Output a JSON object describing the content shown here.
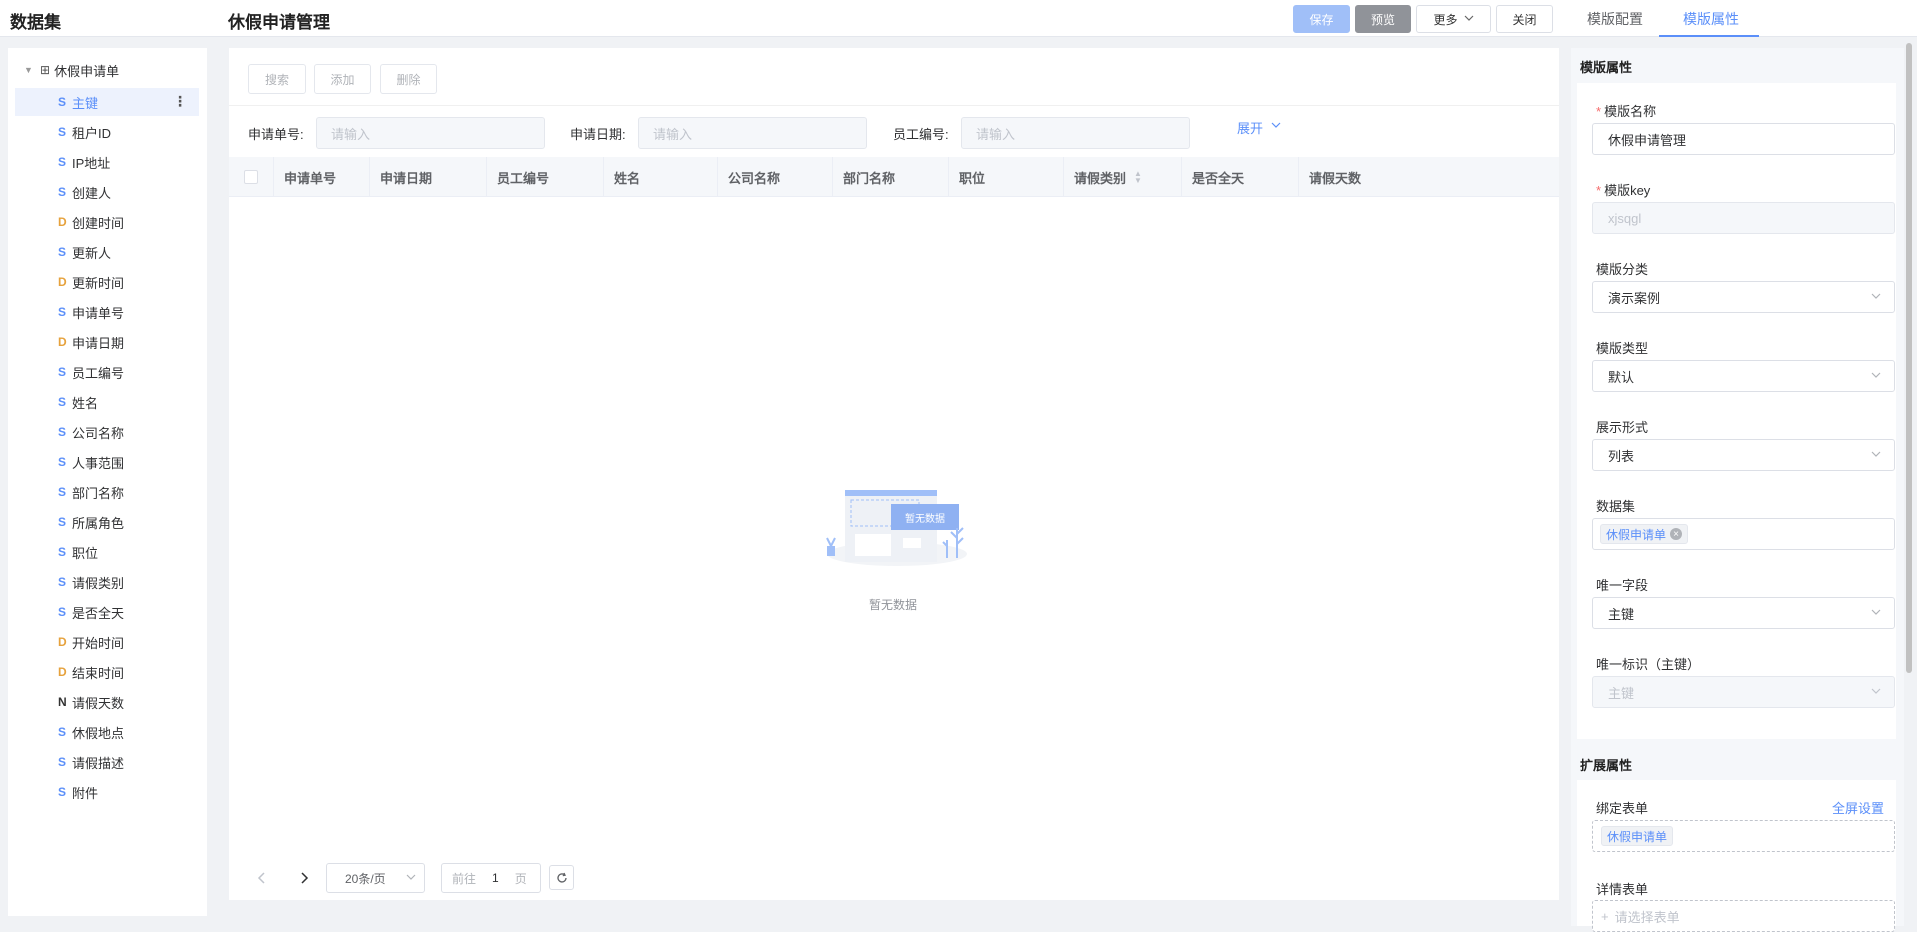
{
  "header": {
    "brand": "数据集",
    "page_title": "休假申请管理",
    "save": "保存",
    "preview": "预览",
    "more": "更多",
    "close": "关闭",
    "tab_config": "模版配置",
    "tab_props": "模版属性"
  },
  "tree": {
    "root": "休假申请单",
    "items": [
      {
        "type": "S",
        "name": "主键"
      },
      {
        "type": "S",
        "name": "租户ID"
      },
      {
        "type": "S",
        "name": "IP地址"
      },
      {
        "type": "S",
        "name": "创建人"
      },
      {
        "type": "D",
        "name": "创建时间"
      },
      {
        "type": "S",
        "name": "更新人"
      },
      {
        "type": "D",
        "name": "更新时间"
      },
      {
        "type": "S",
        "name": "申请单号"
      },
      {
        "type": "D",
        "name": "申请日期"
      },
      {
        "type": "S",
        "name": "员工编号"
      },
      {
        "type": "S",
        "name": "姓名"
      },
      {
        "type": "S",
        "name": "公司名称"
      },
      {
        "type": "S",
        "name": "人事范围"
      },
      {
        "type": "S",
        "name": "部门名称"
      },
      {
        "type": "S",
        "name": "所属角色"
      },
      {
        "type": "S",
        "name": "职位"
      },
      {
        "type": "S",
        "name": "请假类别"
      },
      {
        "type": "S",
        "name": "是否全天"
      },
      {
        "type": "D",
        "name": "开始时间"
      },
      {
        "type": "D",
        "name": "结束时间"
      },
      {
        "type": "N",
        "name": "请假天数"
      },
      {
        "type": "S",
        "name": "休假地点"
      },
      {
        "type": "S",
        "name": "请假描述"
      },
      {
        "type": "S",
        "name": "附件"
      }
    ]
  },
  "main": {
    "btn_search": "搜索",
    "btn_add": "添加",
    "btn_delete": "删除",
    "filters": [
      {
        "label": "申请单号:",
        "placeholder": "请输入"
      },
      {
        "label": "申请日期:",
        "placeholder": "请输入"
      },
      {
        "label": "员工编号:",
        "placeholder": "请输入"
      }
    ],
    "expand": "展开",
    "columns": [
      "申请单号",
      "申请日期",
      "员工编号",
      "姓名",
      "公司名称",
      "部门名称",
      "职位",
      "请假类别",
      "是否全天",
      "请假天数"
    ],
    "empty_badge": "暂无数据",
    "empty_text": "暂无数据",
    "page_size": "20条/页",
    "goto_prefix": "前往",
    "goto_page": "1",
    "goto_suffix": "页"
  },
  "props": {
    "section_title": "模版属性",
    "name_label": "模版名称",
    "name_value": "休假申请管理",
    "key_label": "模版key",
    "key_value": "xjsqgl",
    "category_label": "模版分类",
    "category_value": "演示案例",
    "type_label": "模版类型",
    "type_value": "默认",
    "display_label": "展示形式",
    "display_value": "列表",
    "dataset_label": "数据集",
    "dataset_tag": "休假申请单",
    "unique_label": "唯一字段",
    "unique_value": "主键",
    "uid_label": "唯一标识（主键）",
    "uid_value": "主键",
    "ext_title": "扩展属性",
    "bind_form_label": "绑定表单",
    "fullscreen": "全屏设置",
    "bind_form_tag": "休假申请单",
    "detail_form_label": "详情表单",
    "detail_placeholder": "请选择表单"
  }
}
